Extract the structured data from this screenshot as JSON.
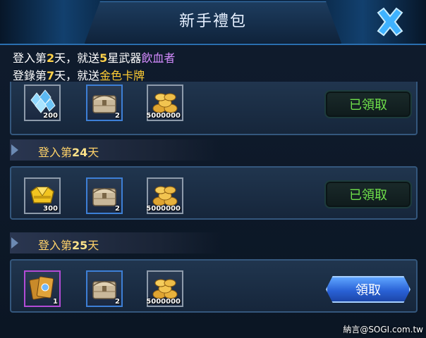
{
  "header": {
    "title": "新手禮包"
  },
  "info": {
    "line1": {
      "a": "登入第",
      "day": "2",
      "b": "天，就送",
      "star": "5",
      "c": "星武器",
      "weapon": "飲血者"
    },
    "line2": {
      "a": "登錄第",
      "day": "7",
      "b": "天，就送",
      "reward": "金色卡牌"
    }
  },
  "rows": [
    {
      "items": [
        {
          "icon": "crystal-icon",
          "qty": "200"
        },
        {
          "icon": "chest-icon",
          "qty": "2"
        },
        {
          "icon": "gold-coins-icon",
          "qty": "5000000"
        }
      ],
      "button": "已領取"
    },
    {
      "day_label": {
        "a": "登入第",
        "day": "24",
        "b": "天"
      },
      "items": [
        {
          "icon": "gold-ingot-icon",
          "qty": "300"
        },
        {
          "icon": "chest-icon",
          "qty": "2"
        },
        {
          "icon": "gold-coins-icon",
          "qty": "5000000"
        }
      ],
      "button": "已領取"
    },
    {
      "day_label": {
        "a": "登入第",
        "day": "25",
        "b": "天"
      },
      "items": [
        {
          "icon": "gold-card-icon",
          "qty": "1"
        },
        {
          "icon": "chest-icon",
          "qty": "2"
        },
        {
          "icon": "gold-coins-icon",
          "qty": "5000000"
        }
      ],
      "button": "領取"
    }
  ],
  "watermark": "納言@SOGI.com.tw",
  "colors": {
    "accent": "#2a6fb0",
    "claimed_text": "#6fe04a",
    "highlight": "#ffd24a",
    "weapon": "#d58cff"
  }
}
